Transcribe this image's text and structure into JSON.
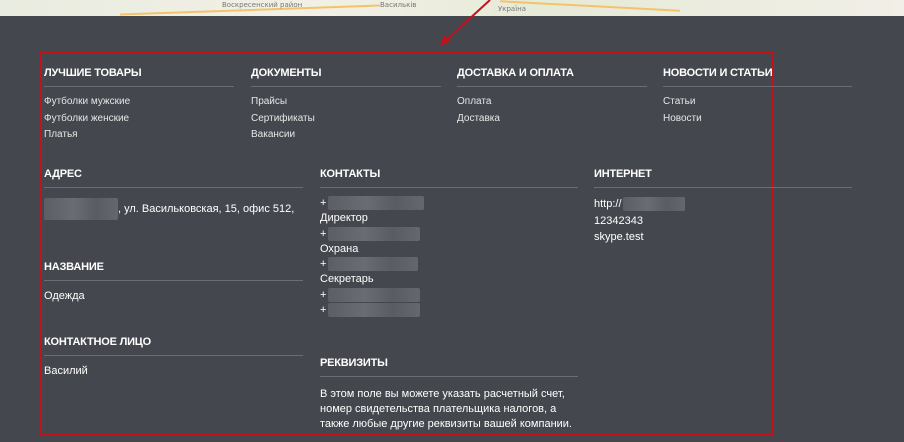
{
  "map": {
    "labels": [
      "Воскресенский район",
      "Васильків",
      "Україна"
    ]
  },
  "menu": [
    {
      "title": "ЛУЧШИЕ ТОВАРЫ",
      "items": [
        "Футболки мужские",
        "Футболки женские",
        "Платья"
      ]
    },
    {
      "title": "ДОКУМЕНТЫ",
      "items": [
        "Прайсы",
        "Сертификаты",
        "Вакансии"
      ]
    },
    {
      "title": "ДОСТАВКА И ОПЛАТА",
      "items": [
        "Оплата",
        "Доставка"
      ]
    },
    {
      "title": "НОВОСТИ И СТАТЬИ",
      "items": [
        "Статьи",
        "Новости"
      ]
    }
  ],
  "address": {
    "title": "АДРЕС",
    "text": ", ул. Васильковская, 15, офис 512,"
  },
  "name": {
    "title": "НАЗВАНИЕ",
    "value": "Одежда"
  },
  "contact_person": {
    "title": "КОНТАКТНОЕ ЛИЦО",
    "value": "Василий"
  },
  "contacts": {
    "title": "КОНТАКТЫ",
    "plus": "+",
    "roles": [
      "Директор",
      "Охрана",
      "Секретарь"
    ]
  },
  "requisites": {
    "title": "РЕКВИЗИТЫ",
    "lines": [
      "В этом поле вы можете указать расчетный счет,",
      "номер свидетельства плательщика налогов, а",
      "также любые другие реквизиты вашей компании."
    ]
  },
  "internet": {
    "title": "ИНТЕРНЕТ",
    "url_prefix": "http://",
    "phone": "12342343",
    "skype": "skype.test"
  },
  "colors": {
    "background": "#45474e",
    "highlight_frame": "#c1131b",
    "divider": "#6b6d74"
  }
}
